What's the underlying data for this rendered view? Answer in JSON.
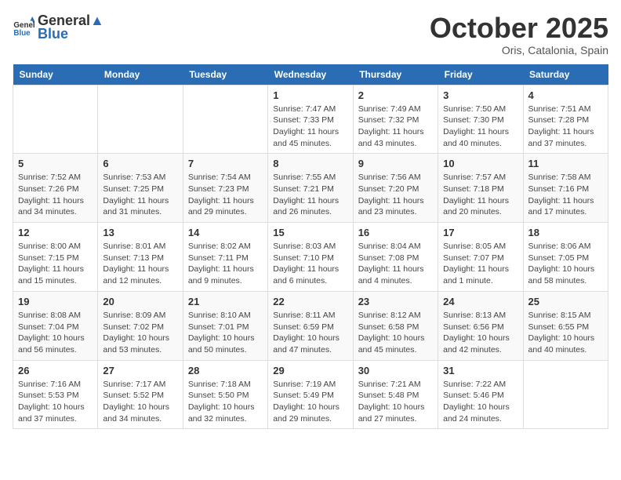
{
  "header": {
    "logo_general": "General",
    "logo_blue": "Blue",
    "month": "October 2025",
    "location": "Oris, Catalonia, Spain"
  },
  "weekdays": [
    "Sunday",
    "Monday",
    "Tuesday",
    "Wednesday",
    "Thursday",
    "Friday",
    "Saturday"
  ],
  "weeks": [
    [
      {
        "day": "",
        "info": ""
      },
      {
        "day": "",
        "info": ""
      },
      {
        "day": "",
        "info": ""
      },
      {
        "day": "1",
        "info": "Sunrise: 7:47 AM\nSunset: 7:33 PM\nDaylight: 11 hours and 45 minutes."
      },
      {
        "day": "2",
        "info": "Sunrise: 7:49 AM\nSunset: 7:32 PM\nDaylight: 11 hours and 43 minutes."
      },
      {
        "day": "3",
        "info": "Sunrise: 7:50 AM\nSunset: 7:30 PM\nDaylight: 11 hours and 40 minutes."
      },
      {
        "day": "4",
        "info": "Sunrise: 7:51 AM\nSunset: 7:28 PM\nDaylight: 11 hours and 37 minutes."
      }
    ],
    [
      {
        "day": "5",
        "info": "Sunrise: 7:52 AM\nSunset: 7:26 PM\nDaylight: 11 hours and 34 minutes."
      },
      {
        "day": "6",
        "info": "Sunrise: 7:53 AM\nSunset: 7:25 PM\nDaylight: 11 hours and 31 minutes."
      },
      {
        "day": "7",
        "info": "Sunrise: 7:54 AM\nSunset: 7:23 PM\nDaylight: 11 hours and 29 minutes."
      },
      {
        "day": "8",
        "info": "Sunrise: 7:55 AM\nSunset: 7:21 PM\nDaylight: 11 hours and 26 minutes."
      },
      {
        "day": "9",
        "info": "Sunrise: 7:56 AM\nSunset: 7:20 PM\nDaylight: 11 hours and 23 minutes."
      },
      {
        "day": "10",
        "info": "Sunrise: 7:57 AM\nSunset: 7:18 PM\nDaylight: 11 hours and 20 minutes."
      },
      {
        "day": "11",
        "info": "Sunrise: 7:58 AM\nSunset: 7:16 PM\nDaylight: 11 hours and 17 minutes."
      }
    ],
    [
      {
        "day": "12",
        "info": "Sunrise: 8:00 AM\nSunset: 7:15 PM\nDaylight: 11 hours and 15 minutes."
      },
      {
        "day": "13",
        "info": "Sunrise: 8:01 AM\nSunset: 7:13 PM\nDaylight: 11 hours and 12 minutes."
      },
      {
        "day": "14",
        "info": "Sunrise: 8:02 AM\nSunset: 7:11 PM\nDaylight: 11 hours and 9 minutes."
      },
      {
        "day": "15",
        "info": "Sunrise: 8:03 AM\nSunset: 7:10 PM\nDaylight: 11 hours and 6 minutes."
      },
      {
        "day": "16",
        "info": "Sunrise: 8:04 AM\nSunset: 7:08 PM\nDaylight: 11 hours and 4 minutes."
      },
      {
        "day": "17",
        "info": "Sunrise: 8:05 AM\nSunset: 7:07 PM\nDaylight: 11 hours and 1 minute."
      },
      {
        "day": "18",
        "info": "Sunrise: 8:06 AM\nSunset: 7:05 PM\nDaylight: 10 hours and 58 minutes."
      }
    ],
    [
      {
        "day": "19",
        "info": "Sunrise: 8:08 AM\nSunset: 7:04 PM\nDaylight: 10 hours and 56 minutes."
      },
      {
        "day": "20",
        "info": "Sunrise: 8:09 AM\nSunset: 7:02 PM\nDaylight: 10 hours and 53 minutes."
      },
      {
        "day": "21",
        "info": "Sunrise: 8:10 AM\nSunset: 7:01 PM\nDaylight: 10 hours and 50 minutes."
      },
      {
        "day": "22",
        "info": "Sunrise: 8:11 AM\nSunset: 6:59 PM\nDaylight: 10 hours and 47 minutes."
      },
      {
        "day": "23",
        "info": "Sunrise: 8:12 AM\nSunset: 6:58 PM\nDaylight: 10 hours and 45 minutes."
      },
      {
        "day": "24",
        "info": "Sunrise: 8:13 AM\nSunset: 6:56 PM\nDaylight: 10 hours and 42 minutes."
      },
      {
        "day": "25",
        "info": "Sunrise: 8:15 AM\nSunset: 6:55 PM\nDaylight: 10 hours and 40 minutes."
      }
    ],
    [
      {
        "day": "26",
        "info": "Sunrise: 7:16 AM\nSunset: 5:53 PM\nDaylight: 10 hours and 37 minutes."
      },
      {
        "day": "27",
        "info": "Sunrise: 7:17 AM\nSunset: 5:52 PM\nDaylight: 10 hours and 34 minutes."
      },
      {
        "day": "28",
        "info": "Sunrise: 7:18 AM\nSunset: 5:50 PM\nDaylight: 10 hours and 32 minutes."
      },
      {
        "day": "29",
        "info": "Sunrise: 7:19 AM\nSunset: 5:49 PM\nDaylight: 10 hours and 29 minutes."
      },
      {
        "day": "30",
        "info": "Sunrise: 7:21 AM\nSunset: 5:48 PM\nDaylight: 10 hours and 27 minutes."
      },
      {
        "day": "31",
        "info": "Sunrise: 7:22 AM\nSunset: 5:46 PM\nDaylight: 10 hours and 24 minutes."
      },
      {
        "day": "",
        "info": ""
      }
    ]
  ]
}
